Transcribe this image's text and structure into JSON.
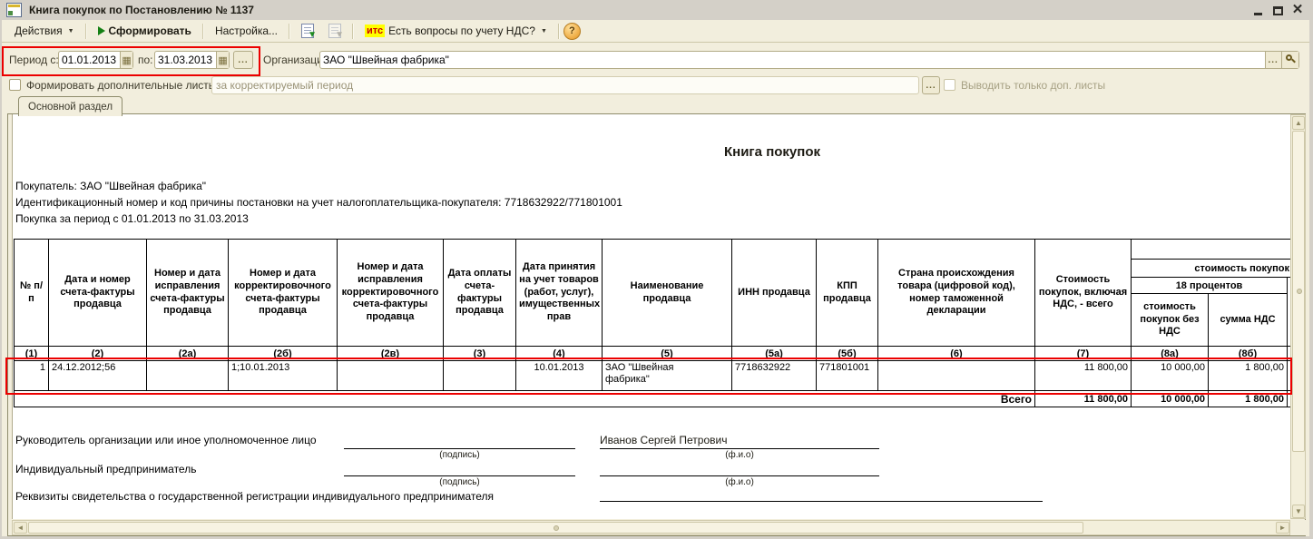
{
  "titlebar": {
    "title": "Книга покупок по Постановлению № 1137"
  },
  "toolbar": {
    "actions_label": "Действия",
    "generate_label": "Сформировать",
    "settings_label": "Настройка...",
    "its_badge": "итс",
    "its_question": "Есть вопросы по учету НДС?"
  },
  "filters": {
    "period_label": "Период с:",
    "period_from": "01.01.2013",
    "to_label": "по:",
    "period_to": "31.03.2013",
    "more_button": "...",
    "organization_label": "Организация:",
    "organization_value": "ЗАО \"Швейная фабрика\"",
    "form_extra_sheets_label": "Формировать дополнительные листы",
    "adjusted_period_placeholder": "за корректируемый период",
    "only_extra_sheets_label": "Выводить только доп. листы"
  },
  "tabs": {
    "main": "Основной раздел"
  },
  "report": {
    "title": "Книга покупок",
    "buyer": "Покупатель:  ЗАО \"Швейная фабрика\"",
    "tax_id": "Идентификационный номер и код причины постановки на учет налогоплательщика-покупателя:  7718632922/771801001",
    "period": "Покупка за период с 01.01.2013 по 31.03.2013"
  },
  "table": {
    "headers": [
      "№ п/п",
      "Дата и номер счета-фактуры продавца",
      "Номер и дата исправления счета-фактуры продавца",
      "Номер и дата корректировочного счета-фактуры продавца",
      "Номер и дата исправления корректировочного счета-фактуры продавца",
      "Дата оплаты счета-фактуры продавца",
      "Дата принятия на учет  товаров (работ, услуг), имущественных прав",
      "Наименование продавца",
      "ИНН продавца",
      "КПП продавца",
      "Страна происхождения товара (цифровой код), номер таможенной декларации",
      "Стоимость покупок, включая НДС, - всего"
    ],
    "group": {
      "cost": "стоимость покупок",
      "rate": "18 процентов",
      "net": "стоимость покупок без НДС",
      "vat": "сумма НДС"
    },
    "codes": [
      "(1)",
      "(2)",
      "(2а)",
      "(2б)",
      "(2в)",
      "(3)",
      "(4)",
      "(5)",
      "(5а)",
      "(5б)",
      "(6)",
      "(7)",
      "(8а)",
      "(8б)"
    ],
    "row": {
      "n": "1",
      "invoice": "24.12.2012;56",
      "correction": "",
      "corrective": "1;10.01.2013",
      "corrective_fix": "",
      "payment_date": "",
      "accept_date": "10.01.2013",
      "seller": "ЗАО \"Швейная фабрика\"",
      "inn": "7718632922",
      "kpp": "771801001",
      "country": "",
      "total_with_vat": "11 800,00",
      "net": "10 000,00",
      "vat": "1 800,00"
    },
    "total_label": "Всего",
    "totals": {
      "total_with_vat": "11 800,00",
      "net": "10 000,00",
      "vat": "1 800,00"
    }
  },
  "signatures": {
    "head_label": "Руководитель организации или иное уполномоченное лицо",
    "head_name": "Иванов Сергей Петрович",
    "sign_caption": "(подпись)",
    "name_caption": "(ф.и.о)",
    "entrepreneur_label": "Индивидуальный предприниматель",
    "registration_label": "Реквизиты свидетельства о государственной регистрации индивидуального предпринимателя"
  },
  "colors": {
    "highlight_red": "#ec0000",
    "its_badge_bg": "#ffff00",
    "its_badge_text": "#cc0000",
    "panel_bg": "#f2eedd"
  }
}
